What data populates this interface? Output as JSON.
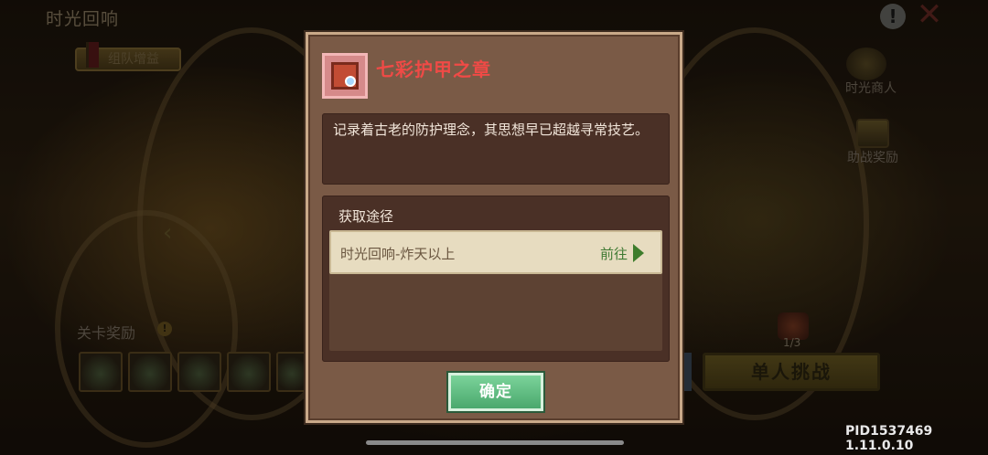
{
  "screen": {
    "title": "时光回响"
  },
  "left_panel": {
    "team_buff_label": "组队增益",
    "stage_reward_title": "关卡奖励",
    "reward_info_glyph": "!"
  },
  "right_panel": {
    "merchant_label": "时光商人",
    "assist_reward_label": "助战奖励",
    "stamina_count": "1/3",
    "solo_challenge_label": "单人挑战"
  },
  "dialog": {
    "item_name": "七彩护甲之章",
    "item_name_color": "#f04a46",
    "description": "记录着古老的防护理念，其思想早已超越寻常技艺。",
    "sources_title": "获取途径",
    "sources": [
      {
        "label": "时光回响-炸天以上",
        "action_label": "前往"
      }
    ],
    "confirm_label": "确定",
    "confirm_color": "#5cbc80"
  },
  "footer": {
    "version": "PID1537469 1.11.0.10"
  },
  "icons": {
    "info": "!",
    "close": "✕"
  }
}
